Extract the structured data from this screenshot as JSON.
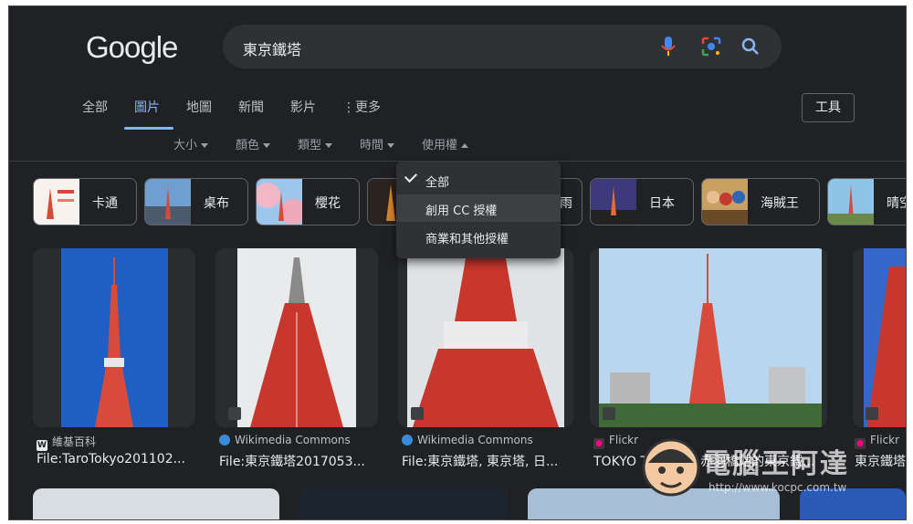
{
  "search": {
    "query": "東京鐵塔"
  },
  "nav": {
    "tabs": [
      {
        "label": "全部"
      },
      {
        "label": "圖片"
      },
      {
        "label": "地圖"
      },
      {
        "label": "新聞"
      },
      {
        "label": "影片"
      },
      {
        "label": "更多"
      }
    ],
    "tools_label": "工具"
  },
  "filters": [
    {
      "label": "大小"
    },
    {
      "label": "顏色"
    },
    {
      "label": "類型"
    },
    {
      "label": "時間"
    },
    {
      "label": "使用權"
    }
  ],
  "usage_menu": {
    "items": [
      {
        "label": "全部",
        "checked": true
      },
      {
        "label": "創用 CC 授權",
        "checked": false
      },
      {
        "label": "商業和其他授權",
        "checked": false
      }
    ]
  },
  "chips": [
    {
      "label": "卡通"
    },
    {
      "label": "桌布"
    },
    {
      "label": "櫻花"
    },
    {
      "label": "雨"
    },
    {
      "label": "日本"
    },
    {
      "label": "海賊王"
    },
    {
      "label": "晴空"
    }
  ],
  "results": [
    {
      "source": "維基百科",
      "title": "File:TaroTokyo201102..."
    },
    {
      "source": "Wikimedia Commons",
      "title": "File:東京鐵塔2017053..."
    },
    {
      "source": "Wikimedia Commons",
      "title": "File:東京鐵塔, 東京塔, 日..."
    },
    {
      "source": "Flickr",
      "title": "TOKYO TOWER | 赤羽橋站的東京鐵..."
    },
    {
      "source": "Flickr",
      "title": "東京鐵塔"
    }
  ],
  "watermark": {
    "text": "電腦王阿達",
    "url": "http://www.kocpc.com.tw"
  },
  "colors": {
    "background": "#202124",
    "accent": "#8ab4f8",
    "tower_red": "#c8372d"
  }
}
